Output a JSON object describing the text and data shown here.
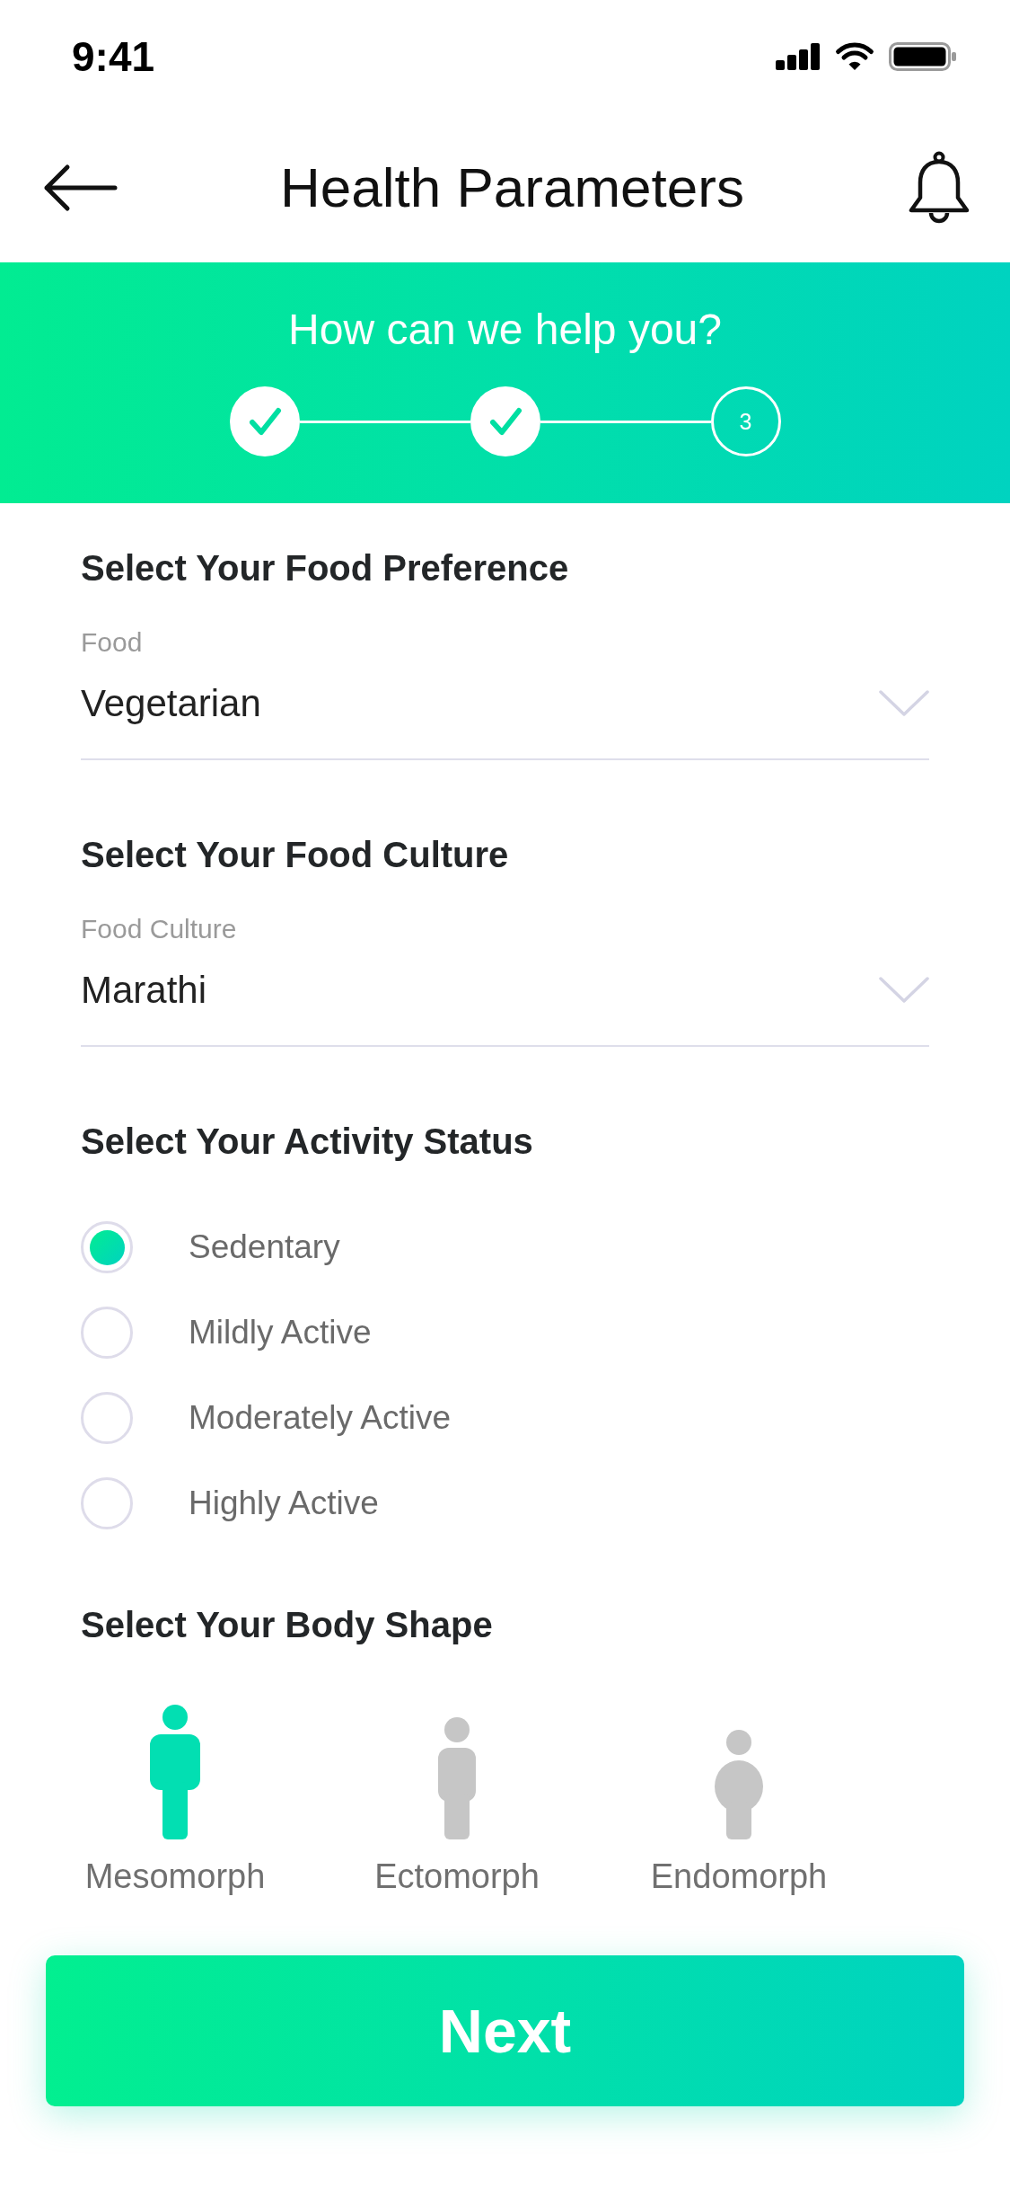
{
  "status_bar": {
    "time": "9:41"
  },
  "header": {
    "title": "Health Parameters"
  },
  "banner": {
    "title": "How can we help you?",
    "steps": [
      {
        "done": true
      },
      {
        "done": true
      },
      {
        "done": false,
        "label": "3"
      }
    ]
  },
  "sections": [
    {
      "kind": "dropdown",
      "heading": "Select Your Food Preference",
      "label": "Food",
      "value": "Vegetarian"
    },
    {
      "kind": "dropdown",
      "heading": "Select Your Food Culture",
      "label": "Food Culture",
      "value": "Marathi"
    },
    {
      "kind": "radio",
      "heading": "Select Your Activity Status",
      "options": [
        {
          "label": "Sedentary",
          "selected": true
        },
        {
          "label": "Mildly Active",
          "selected": false
        },
        {
          "label": "Moderately Active",
          "selected": false
        },
        {
          "label": "Highly Active",
          "selected": false
        }
      ]
    },
    {
      "kind": "body_shape",
      "heading": "Select Your Body Shape",
      "options": [
        {
          "label": "Mesomorph",
          "selected": true
        },
        {
          "label": "Ectomorph",
          "selected": false
        },
        {
          "label": "Endomorph",
          "selected": false
        }
      ]
    }
  ],
  "next_button": {
    "label": "Next"
  }
}
